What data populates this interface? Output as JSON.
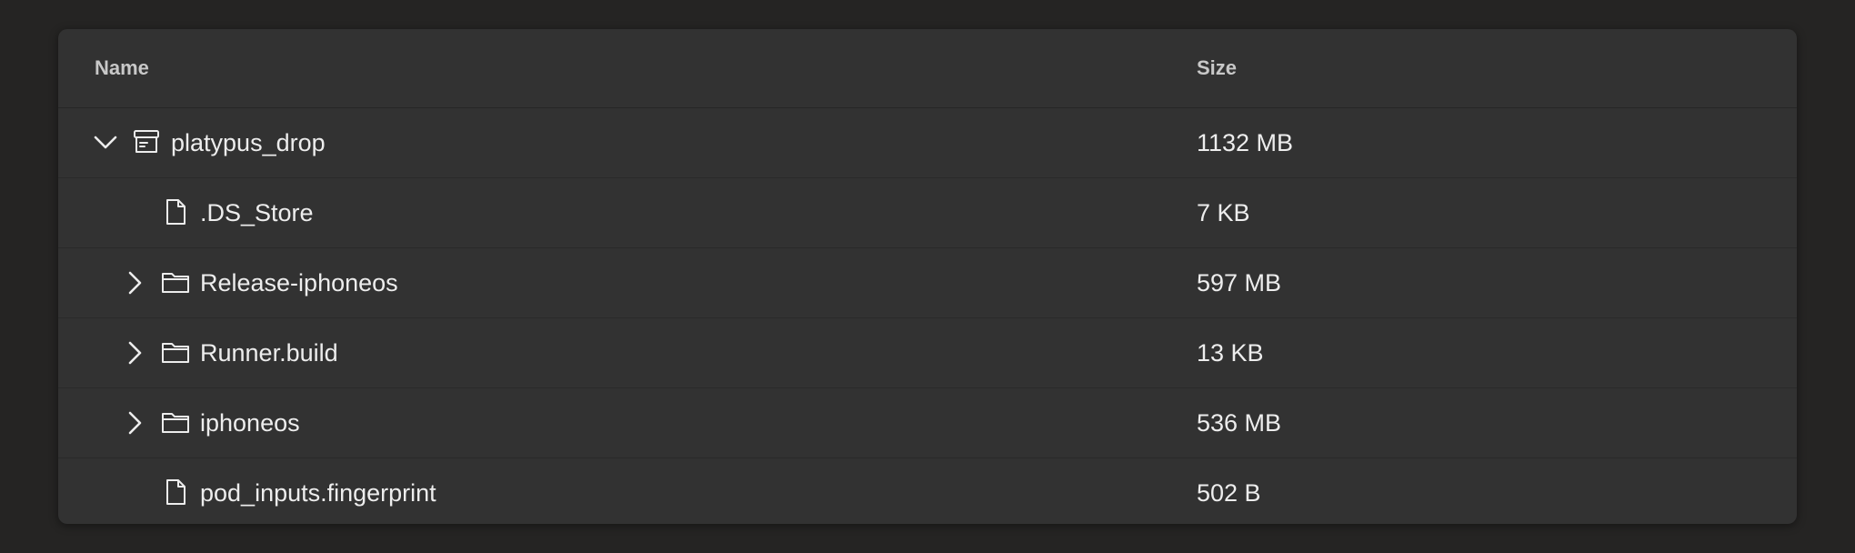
{
  "table": {
    "columns": {
      "name": "Name",
      "size": "Size"
    },
    "rows": [
      {
        "name": "platypus_drop",
        "size": "1132 MB",
        "icon": "archive-icon",
        "expandable": true,
        "expanded": true,
        "depth": 0
      },
      {
        "name": ".DS_Store",
        "size": "7 KB",
        "icon": "file-icon",
        "expandable": false,
        "depth": 1
      },
      {
        "name": "Release-iphoneos",
        "size": "597 MB",
        "icon": "folder-icon",
        "expandable": true,
        "expanded": false,
        "depth": 1
      },
      {
        "name": "Runner.build",
        "size": "13 KB",
        "icon": "folder-icon",
        "expandable": true,
        "expanded": false,
        "depth": 1
      },
      {
        "name": "iphoneos",
        "size": "536 MB",
        "icon": "folder-icon",
        "expandable": true,
        "expanded": false,
        "depth": 1
      },
      {
        "name": "pod_inputs.fingerprint",
        "size": "502 B",
        "icon": "file-icon",
        "expandable": false,
        "depth": 1
      }
    ]
  },
  "colors": {
    "background": "#252423",
    "panel": "#323232",
    "text": "#ededed",
    "header_text": "#c8c8c8"
  }
}
